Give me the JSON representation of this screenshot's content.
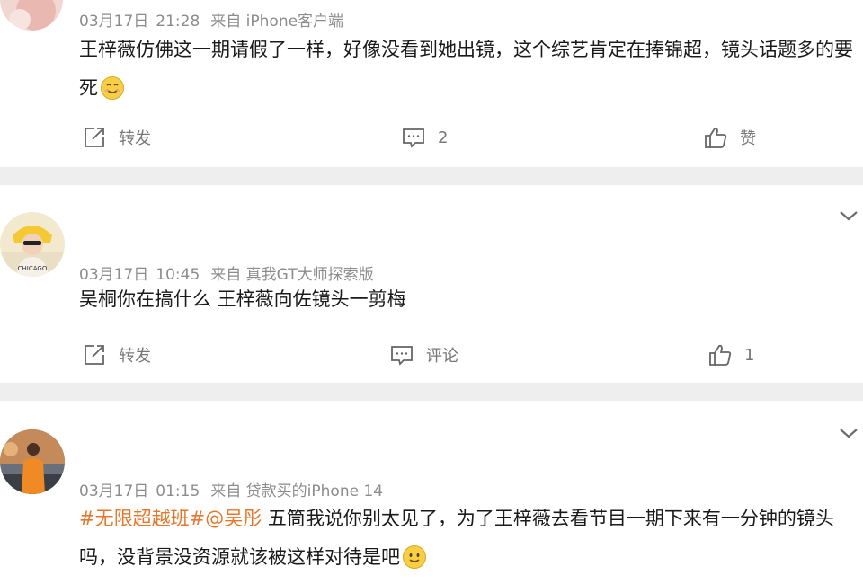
{
  "comments": [
    {
      "date": "03月17日",
      "time": "21:28",
      "source": "来自 iPhone客户端",
      "text": "王梓薇仿佛这一期请假了一样，好像没看到她出镜，这个综艺肯定在捧锦超，镜头话题多的要死",
      "topic": "",
      "actions": {
        "repost": "转发",
        "comment": "2",
        "like": "赞"
      }
    },
    {
      "date": "03月17日",
      "time": "10:45",
      "source": "来自 真我GT大师探索版",
      "text": "吴桐你在搞什么 王梓薇向佐镜头一剪梅",
      "topic": "",
      "actions": {
        "repost": "转发",
        "comment": "评论",
        "like": "1"
      }
    },
    {
      "date": "03月17日",
      "time": "01:15",
      "source": "来自 贷款买的iPhone 14",
      "text": "五筒我说你别太见了，为了王梓薇去看节目一期下来有一分钟的镜头吗，没背景没资源就该被这样对待是吧",
      "topic": "#无限超越班#@吴彤",
      "actions": null
    }
  ],
  "icons": {
    "repost": "repost-icon",
    "comment": "comment-icon",
    "like": "thumbs-up-icon",
    "more": "chevron-down-icon",
    "emoji": "smile-emoji-icon"
  },
  "colors": {
    "topic": "#e8762a",
    "separator": "#eeeeee",
    "meta": "#8c8c8c"
  }
}
